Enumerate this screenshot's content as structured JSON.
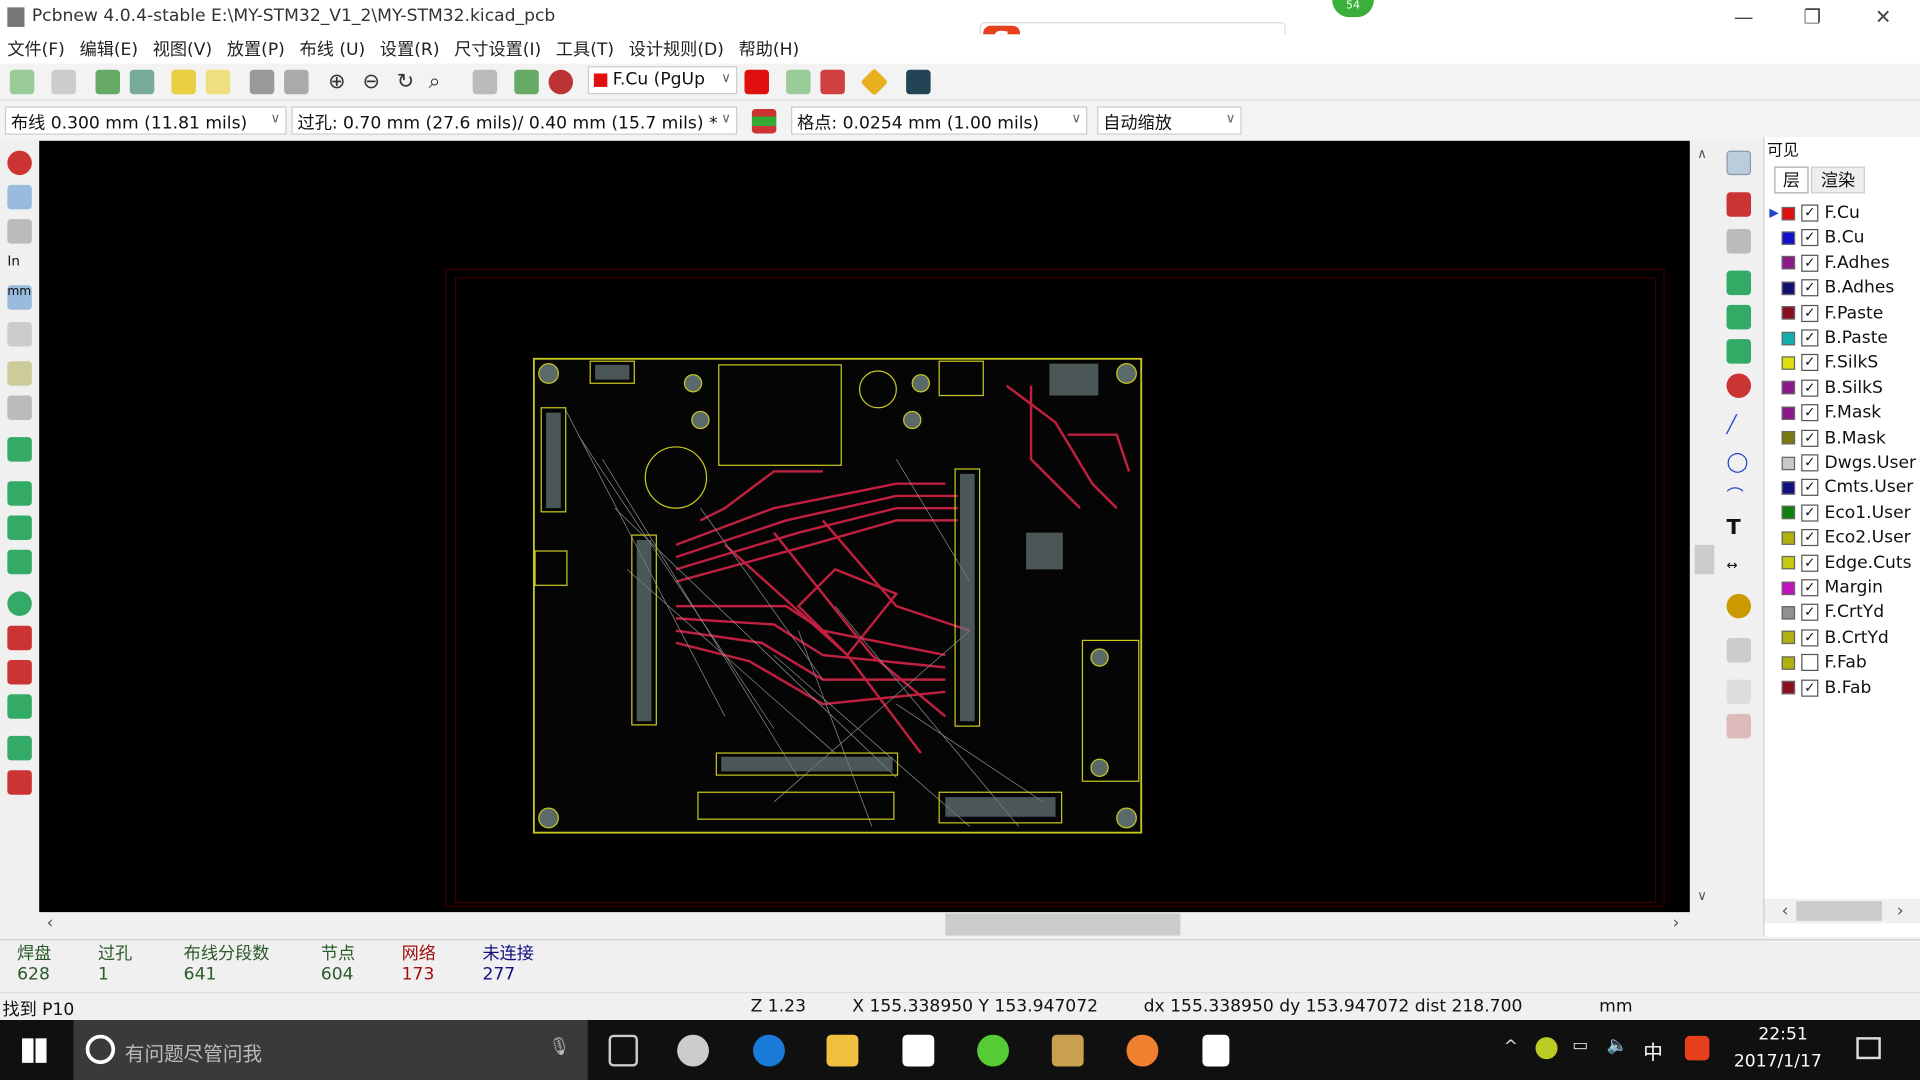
{
  "window": {
    "title": "Pcbnew 4.0.4-stable E:\\MY-STM32_V1_2\\MY-STM32.kicad_pcb"
  },
  "menu": [
    "文件(F)",
    "编辑(E)",
    "视图(V)",
    "放置(P)",
    "布线 (U)",
    "设置(R)",
    "尺寸设置(I)",
    "工具(T)",
    "设计规则(D)",
    "帮助(H)"
  ],
  "toolbar": {
    "layer_select": "F.Cu (PgUp",
    "track_width": "布线 0.300 mm (11.81 mils)",
    "via_size": "过孔: 0.70 mm (27.6 mils)/ 0.40 mm (15.7 mils) *",
    "grid": "格点: 0.0254 mm (1.00 mils)",
    "zoom": "自动缩放"
  },
  "ime": {
    "badge": "54"
  },
  "panel": {
    "title": "可见",
    "tabs": [
      "层",
      "渲染"
    ],
    "layers": [
      {
        "name": "F.Cu",
        "color": "#e01010",
        "checked": true,
        "active": true
      },
      {
        "name": "B.Cu",
        "color": "#1010c8",
        "checked": true
      },
      {
        "name": "F.Adhes",
        "color": "#8a1a8a",
        "checked": true
      },
      {
        "name": "B.Adhes",
        "color": "#101070",
        "checked": true
      },
      {
        "name": "F.Paste",
        "color": "#8a1020",
        "checked": true
      },
      {
        "name": "B.Paste",
        "color": "#10b0b0",
        "checked": true
      },
      {
        "name": "F.SilkS",
        "color": "#e0e010",
        "checked": true
      },
      {
        "name": "B.SilkS",
        "color": "#8a1a8a",
        "checked": true
      },
      {
        "name": "F.Mask",
        "color": "#8a1a8a",
        "checked": true
      },
      {
        "name": "B.Mask",
        "color": "#7a7a10",
        "checked": true
      },
      {
        "name": "Dwgs.User",
        "color": "#c8c8c8",
        "checked": true
      },
      {
        "name": "Cmts.User",
        "color": "#101080",
        "checked": true
      },
      {
        "name": "Eco1.User",
        "color": "#108010",
        "checked": true
      },
      {
        "name": "Eco2.User",
        "color": "#b0b010",
        "checked": true
      },
      {
        "name": "Edge.Cuts",
        "color": "#c8c810",
        "checked": true
      },
      {
        "name": "Margin",
        "color": "#c010c0",
        "checked": true
      },
      {
        "name": "F.CrtYd",
        "color": "#909090",
        "checked": true
      },
      {
        "name": "B.CrtYd",
        "color": "#b0b010",
        "checked": true
      },
      {
        "name": "F.Fab",
        "color": "#b0b010",
        "checked": false
      },
      {
        "name": "B.Fab",
        "color": "#8a1020",
        "checked": true
      }
    ]
  },
  "stats": [
    {
      "label": "焊盘",
      "value": "628",
      "color": "#2a5a2a"
    },
    {
      "label": "过孔",
      "value": "1",
      "color": "#2a5a2a"
    },
    {
      "label": "布线分段数",
      "value": "641",
      "color": "#2a5a2a"
    },
    {
      "label": "节点",
      "value": "604",
      "color": "#2a5a2a"
    },
    {
      "label": "网络",
      "value": "173",
      "color": "#a01010"
    },
    {
      "label": "未连接",
      "value": "277",
      "color": "#101080"
    }
  ],
  "status": {
    "message": "找到 P10",
    "zoom": "Z 1.23",
    "xy": "X 155.338950  Y 153.947072",
    "delta": "dx 155.338950  dy 153.947072  dist 218.700",
    "units": "mm"
  },
  "taskbar": {
    "search_placeholder": "有问题尽管问我",
    "time": "22:51",
    "date": "2017/1/17",
    "ime": "中"
  }
}
